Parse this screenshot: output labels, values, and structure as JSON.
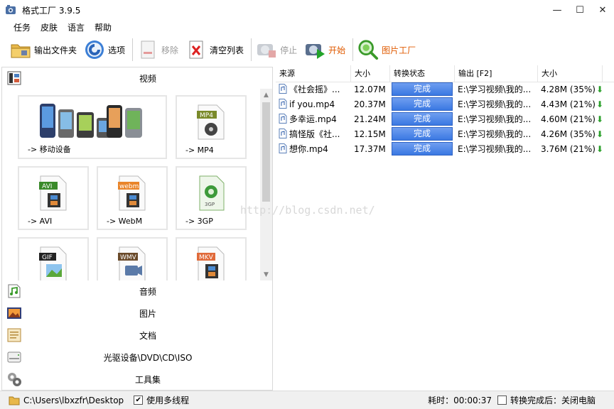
{
  "window": {
    "title": "格式工厂 3.9.5",
    "controls": {
      "minimize": "—",
      "maximize": "☐",
      "close": "✕"
    }
  },
  "menu": [
    "任务",
    "皮肤",
    "语言",
    "帮助"
  ],
  "toolbar": {
    "output_folder": "输出文件夹",
    "options": "选项",
    "remove": "移除",
    "clear_list": "清空列表",
    "stop": "停止",
    "start": "开始",
    "picture_factory": "图片工厂"
  },
  "left": {
    "video_header": "视频",
    "tiles": [
      {
        "label": "-> 移动设备",
        "icon": "mobile-devices-icon"
      },
      {
        "label": "-> MP4",
        "icon": "mp4-icon",
        "badge": "MP4"
      },
      {
        "label": "-> AVI",
        "icon": "avi-icon",
        "badge": "AVI"
      },
      {
        "label": "-> WebM",
        "icon": "webm-icon",
        "badge": "webm"
      },
      {
        "label": "-> 3GP",
        "icon": "3gp-icon",
        "badge": "3GP"
      },
      {
        "label": "",
        "icon": "gif-icon",
        "badge": "GIF"
      },
      {
        "label": "",
        "icon": "wmv-icon",
        "badge": "WMV"
      },
      {
        "label": "",
        "icon": "mkv-icon",
        "badge": "MKV"
      }
    ],
    "categories": [
      {
        "label": "音频",
        "icon": "audio-icon"
      },
      {
        "label": "图片",
        "icon": "picture-icon"
      },
      {
        "label": "文档",
        "icon": "document-icon"
      },
      {
        "label": "光驱设备\\DVD\\CD\\ISO",
        "icon": "optical-drive-icon"
      },
      {
        "label": "工具集",
        "icon": "toolbox-icon"
      }
    ]
  },
  "list": {
    "columns": [
      "来源",
      "大小",
      "转换状态",
      "输出 [F2]",
      "大小"
    ],
    "rows": [
      {
        "source": "《社会摇》...",
        "size": "12.07M",
        "status": "完成",
        "output": "E:\\学习视频\\我的...",
        "out_size": "4.28M",
        "ratio": "(35%)"
      },
      {
        "source": "if you.mp4",
        "size": "20.37M",
        "status": "完成",
        "output": "E:\\学习视频\\我的...",
        "out_size": "4.43M",
        "ratio": "(21%)"
      },
      {
        "source": "多幸运.mp4",
        "size": "21.24M",
        "status": "完成",
        "output": "E:\\学习视频\\我的...",
        "out_size": "4.60M",
        "ratio": "(21%)"
      },
      {
        "source": "搞怪版《社...",
        "size": "12.15M",
        "status": "完成",
        "output": "E:\\学习视频\\我的...",
        "out_size": "4.26M",
        "ratio": "(35%)"
      },
      {
        "source": "想你.mp4",
        "size": "17.37M",
        "status": "完成",
        "output": "E:\\学习视频\\我的...",
        "out_size": "3.76M",
        "ratio": "(21%)"
      }
    ]
  },
  "watermark": "http://blog.csdn.net/",
  "status": {
    "path": "C:\\Users\\lbxzfr\\Desktop",
    "multithread_label": "使用多线程",
    "multithread_checked": "✔",
    "elapsed": "耗时：00:00:37",
    "after_label": "转换完成后：关闭电脑"
  }
}
